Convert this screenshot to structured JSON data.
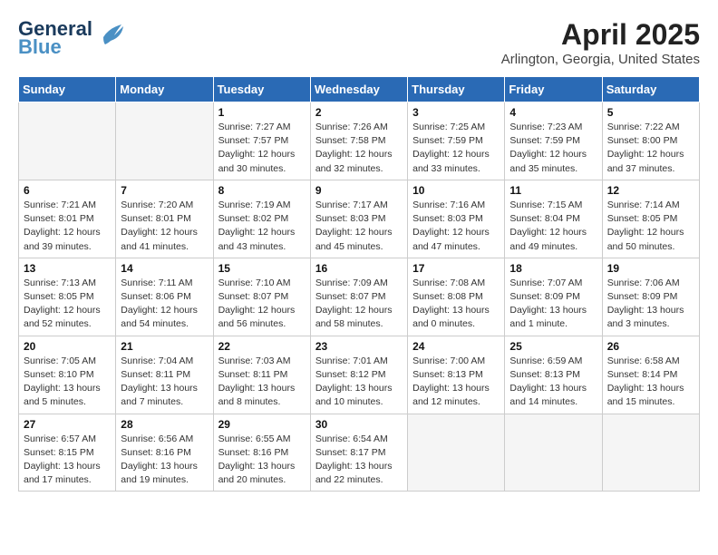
{
  "header": {
    "logo_line1": "General",
    "logo_line2": "Blue",
    "month_year": "April 2025",
    "location": "Arlington, Georgia, United States"
  },
  "weekdays": [
    "Sunday",
    "Monday",
    "Tuesday",
    "Wednesday",
    "Thursday",
    "Friday",
    "Saturday"
  ],
  "weeks": [
    [
      {
        "day": "",
        "info": ""
      },
      {
        "day": "",
        "info": ""
      },
      {
        "day": "1",
        "info": "Sunrise: 7:27 AM\nSunset: 7:57 PM\nDaylight: 12 hours\nand 30 minutes."
      },
      {
        "day": "2",
        "info": "Sunrise: 7:26 AM\nSunset: 7:58 PM\nDaylight: 12 hours\nand 32 minutes."
      },
      {
        "day": "3",
        "info": "Sunrise: 7:25 AM\nSunset: 7:59 PM\nDaylight: 12 hours\nand 33 minutes."
      },
      {
        "day": "4",
        "info": "Sunrise: 7:23 AM\nSunset: 7:59 PM\nDaylight: 12 hours\nand 35 minutes."
      },
      {
        "day": "5",
        "info": "Sunrise: 7:22 AM\nSunset: 8:00 PM\nDaylight: 12 hours\nand 37 minutes."
      }
    ],
    [
      {
        "day": "6",
        "info": "Sunrise: 7:21 AM\nSunset: 8:01 PM\nDaylight: 12 hours\nand 39 minutes."
      },
      {
        "day": "7",
        "info": "Sunrise: 7:20 AM\nSunset: 8:01 PM\nDaylight: 12 hours\nand 41 minutes."
      },
      {
        "day": "8",
        "info": "Sunrise: 7:19 AM\nSunset: 8:02 PM\nDaylight: 12 hours\nand 43 minutes."
      },
      {
        "day": "9",
        "info": "Sunrise: 7:17 AM\nSunset: 8:03 PM\nDaylight: 12 hours\nand 45 minutes."
      },
      {
        "day": "10",
        "info": "Sunrise: 7:16 AM\nSunset: 8:03 PM\nDaylight: 12 hours\nand 47 minutes."
      },
      {
        "day": "11",
        "info": "Sunrise: 7:15 AM\nSunset: 8:04 PM\nDaylight: 12 hours\nand 49 minutes."
      },
      {
        "day": "12",
        "info": "Sunrise: 7:14 AM\nSunset: 8:05 PM\nDaylight: 12 hours\nand 50 minutes."
      }
    ],
    [
      {
        "day": "13",
        "info": "Sunrise: 7:13 AM\nSunset: 8:05 PM\nDaylight: 12 hours\nand 52 minutes."
      },
      {
        "day": "14",
        "info": "Sunrise: 7:11 AM\nSunset: 8:06 PM\nDaylight: 12 hours\nand 54 minutes."
      },
      {
        "day": "15",
        "info": "Sunrise: 7:10 AM\nSunset: 8:07 PM\nDaylight: 12 hours\nand 56 minutes."
      },
      {
        "day": "16",
        "info": "Sunrise: 7:09 AM\nSunset: 8:07 PM\nDaylight: 12 hours\nand 58 minutes."
      },
      {
        "day": "17",
        "info": "Sunrise: 7:08 AM\nSunset: 8:08 PM\nDaylight: 13 hours\nand 0 minutes."
      },
      {
        "day": "18",
        "info": "Sunrise: 7:07 AM\nSunset: 8:09 PM\nDaylight: 13 hours\nand 1 minute."
      },
      {
        "day": "19",
        "info": "Sunrise: 7:06 AM\nSunset: 8:09 PM\nDaylight: 13 hours\nand 3 minutes."
      }
    ],
    [
      {
        "day": "20",
        "info": "Sunrise: 7:05 AM\nSunset: 8:10 PM\nDaylight: 13 hours\nand 5 minutes."
      },
      {
        "day": "21",
        "info": "Sunrise: 7:04 AM\nSunset: 8:11 PM\nDaylight: 13 hours\nand 7 minutes."
      },
      {
        "day": "22",
        "info": "Sunrise: 7:03 AM\nSunset: 8:11 PM\nDaylight: 13 hours\nand 8 minutes."
      },
      {
        "day": "23",
        "info": "Sunrise: 7:01 AM\nSunset: 8:12 PM\nDaylight: 13 hours\nand 10 minutes."
      },
      {
        "day": "24",
        "info": "Sunrise: 7:00 AM\nSunset: 8:13 PM\nDaylight: 13 hours\nand 12 minutes."
      },
      {
        "day": "25",
        "info": "Sunrise: 6:59 AM\nSunset: 8:13 PM\nDaylight: 13 hours\nand 14 minutes."
      },
      {
        "day": "26",
        "info": "Sunrise: 6:58 AM\nSunset: 8:14 PM\nDaylight: 13 hours\nand 15 minutes."
      }
    ],
    [
      {
        "day": "27",
        "info": "Sunrise: 6:57 AM\nSunset: 8:15 PM\nDaylight: 13 hours\nand 17 minutes."
      },
      {
        "day": "28",
        "info": "Sunrise: 6:56 AM\nSunset: 8:16 PM\nDaylight: 13 hours\nand 19 minutes."
      },
      {
        "day": "29",
        "info": "Sunrise: 6:55 AM\nSunset: 8:16 PM\nDaylight: 13 hours\nand 20 minutes."
      },
      {
        "day": "30",
        "info": "Sunrise: 6:54 AM\nSunset: 8:17 PM\nDaylight: 13 hours\nand 22 minutes."
      },
      {
        "day": "",
        "info": ""
      },
      {
        "day": "",
        "info": ""
      },
      {
        "day": "",
        "info": ""
      }
    ]
  ]
}
